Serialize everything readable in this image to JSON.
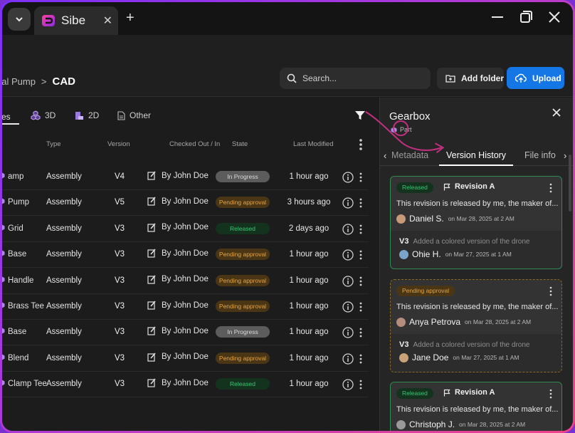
{
  "browser": {
    "tab_title": "Sibe",
    "tab_close": "✕",
    "new_tab": "+"
  },
  "breadcrumb": {
    "parent": "gal Pump",
    "separator": ">",
    "current": "CAD"
  },
  "search": {
    "placeholder": "Search..."
  },
  "toolbar": {
    "add_folder": "Add folder",
    "upload": "Upload"
  },
  "filters": {
    "active_partial": "es",
    "tab_3d": "3D",
    "tab_2d": "2D",
    "tab_other": "Other"
  },
  "columns": {
    "type": "Type",
    "version": "Version",
    "checked_out": "Checked Out / In",
    "state": "State",
    "last_modified": "Last Modified"
  },
  "rows": [
    {
      "name": "amp",
      "type": "Assembly",
      "version": "V4",
      "checked_out": "By John Doe",
      "state": "In Progress",
      "state_kind": "progress",
      "modified": "1 hour ago"
    },
    {
      "name": "Pump",
      "type": "Assembly",
      "version": "V5",
      "checked_out": "By John Doe",
      "state": "Pending approval",
      "state_kind": "pending",
      "modified": "3 hours ago"
    },
    {
      "name": "Grid",
      "type": "Assembly",
      "version": "V3",
      "checked_out": "By John Doe",
      "state": "Released",
      "state_kind": "released",
      "modified": "2 days ago"
    },
    {
      "name": "Base",
      "type": "Assembly",
      "version": "V3",
      "checked_out": "By John Doe",
      "state": "Pending approval",
      "state_kind": "pending",
      "modified": "1 hour ago"
    },
    {
      "name": "Handle",
      "type": "Assembly",
      "version": "V3",
      "checked_out": "By John Doe",
      "state": "Pending approval",
      "state_kind": "pending",
      "modified": "1 hour ago"
    },
    {
      "name": "Brass Tee",
      "type": "Assembly",
      "version": "V3",
      "checked_out": "By John Doe",
      "state": "Pending approval",
      "state_kind": "pending",
      "modified": "1 hour ago"
    },
    {
      "name": "Base",
      "type": "Assembly",
      "version": "V3",
      "checked_out": "By John Doe",
      "state": "In Progress",
      "state_kind": "progress",
      "modified": "1 hour ago"
    },
    {
      "name": "Blend",
      "type": "Assembly",
      "version": "V3",
      "checked_out": "By John Doe",
      "state": "Pending approval",
      "state_kind": "pending",
      "modified": "1 hour ago"
    },
    {
      "name": "Clamp Tee",
      "type": "Assembly",
      "version": "V3",
      "checked_out": "By John Doe",
      "state": "Released",
      "state_kind": "released",
      "modified": "1 hour ago"
    }
  ],
  "panel": {
    "title": "Gearbox",
    "subtitle": "Part",
    "close": "✕",
    "tabs": {
      "left_arrow": "‹",
      "metadata": "Metadata",
      "version_history": "Version History",
      "file_info": "File info",
      "right_arrow": "›"
    },
    "cards": [
      {
        "badge": "Released",
        "badge_kind": "released",
        "revision": "Revision A",
        "description": "This revision is released by me, the maker of...",
        "author": "Daniel S.",
        "date": "on Mar 28, 2025 at 2 AM",
        "prev_version": "V3",
        "prev_message": "Added a colored version of the drone",
        "prev_author": "Ohie H.",
        "prev_date": "on Mar 27, 2025 at 1 AM"
      },
      {
        "badge": "Pending approval",
        "badge_kind": "pending",
        "revision": "",
        "description": "This revision is released by me, the maker of...",
        "author": "Anya Petrova",
        "date": "on Mar 28, 2025 at 2 AM",
        "prev_version": "V3",
        "prev_message": "Added a colored version of the drone",
        "prev_author": "Jane Doe",
        "prev_date": "on Mar 27, 2025 at 1 AM"
      },
      {
        "badge": "Released",
        "badge_kind": "released",
        "revision": "Revision A",
        "description": "This revision is released by me, the maker of...",
        "author": "Christoph J.",
        "date": "on Mar 28, 2025 at 2 AM"
      }
    ]
  },
  "colors": {
    "frame_gradient_start": "#7b2ff7",
    "frame_gradient_end": "#f0428a",
    "upload_button": "#1576e6",
    "released": "#3ec372",
    "pending": "#e3a544",
    "annotation": "#c0307e"
  }
}
